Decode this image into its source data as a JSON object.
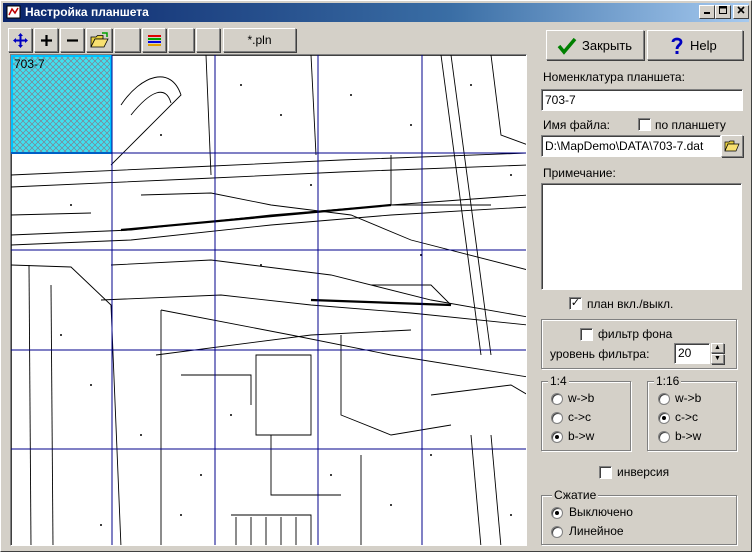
{
  "window": {
    "title": "Настройка планшета"
  },
  "toolbar": {
    "pln_label": "*.pln"
  },
  "map": {
    "tile_label": "703-7"
  },
  "buttons": {
    "close_label": "Закрыть",
    "help_label": "Help"
  },
  "fields": {
    "nomenclature_label": "Номенклатура планшета:",
    "nomenclature_value": "703-7",
    "filename_label": "Имя файла:",
    "by_tile_label": "по планшету",
    "filename_value": "D:\\MapDemo\\DATA\\703-7.dat",
    "note_label": "Примечание:",
    "note_value": "",
    "plan_toggle_label": "план вкл./выкл."
  },
  "filter": {
    "bg_filter_label": "фильтр фона",
    "level_label": "уровень фильтра:",
    "level_value": "20"
  },
  "scale_1_4": {
    "title": "1:4",
    "options": [
      "w->b",
      "c->c",
      "b->w"
    ],
    "selected": "b->w"
  },
  "scale_1_16": {
    "title": "1:16",
    "options": [
      "w->b",
      "c->c",
      "b->w"
    ],
    "selected": "c->c"
  },
  "inversion_label": "инверсия",
  "compression": {
    "title": "Сжатие",
    "options": [
      "Выключено",
      "Линейное"
    ],
    "selected": "Выключено"
  },
  "states": {
    "plan_checked": true,
    "by_tile_checked": false,
    "bg_filter_checked": false,
    "inversion_checked": false
  },
  "icons": {
    "move": "move-arrows-icon",
    "zoom_in": "plus-icon",
    "zoom_out": "minus-icon",
    "open": "open-folder-icon",
    "layers": "layers-icon",
    "browse": "folder-icon",
    "check": "checkmark-icon",
    "help": "question-icon"
  },
  "colors": {
    "title_start": "#0a246a",
    "title_end": "#a6caf0",
    "grid": "#00008b",
    "tile_fill": "#40e0f0"
  }
}
